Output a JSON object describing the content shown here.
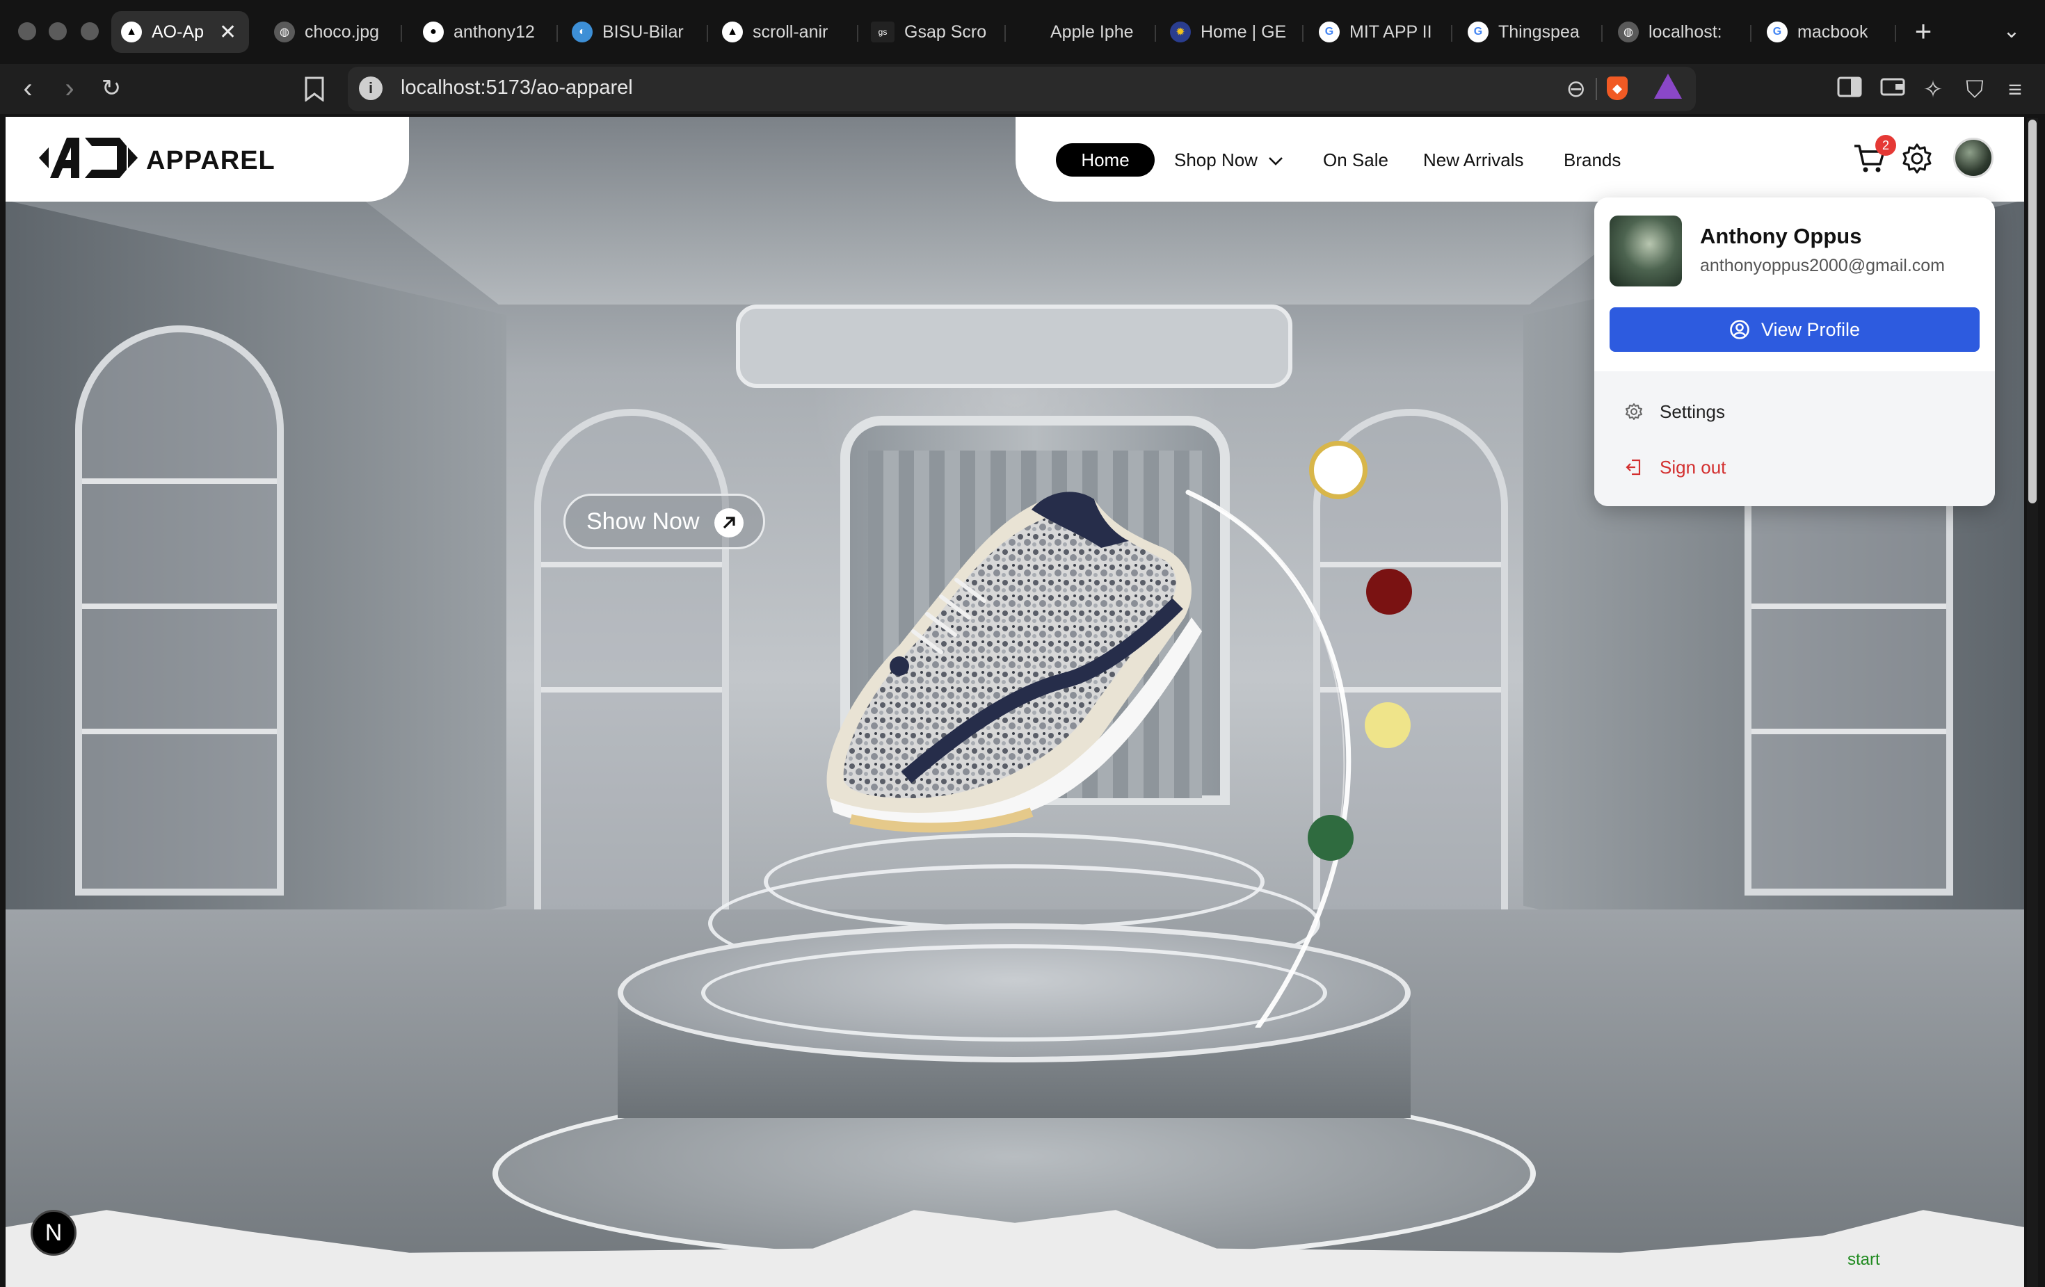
{
  "browser": {
    "tabs": [
      {
        "label": "AO-Ap",
        "active": true
      },
      {
        "label": "choco.jpg"
      },
      {
        "label": "anthony12"
      },
      {
        "label": "BISU-Bilar"
      },
      {
        "label": "scroll-anir"
      },
      {
        "label": "Gsap Scro"
      },
      {
        "label": "Apple Iphe"
      },
      {
        "label": "Home | GE"
      },
      {
        "label": "MIT APP II"
      },
      {
        "label": "Thingspea"
      },
      {
        "label": "localhost:"
      },
      {
        "label": "macbook"
      }
    ],
    "url": "localhost:5173/ao-apparel"
  },
  "header": {
    "brand": "APPAREL",
    "nav": {
      "home": "Home",
      "shop_now": "Shop Now",
      "on_sale": "On Sale",
      "new_arrivals": "New Arrivals",
      "brands": "Brands"
    },
    "cart_count": "2"
  },
  "profile_menu": {
    "name": "Anthony Oppus",
    "email": "anthonyoppus2000@gmail.com",
    "view_profile": "View Profile",
    "settings": "Settings",
    "sign_out": "Sign out"
  },
  "hero": {
    "cta": "Show Now",
    "swatches": [
      "#ffffff",
      "#7a1212",
      "#efe48a",
      "#2f6b3f"
    ]
  },
  "overlay": {
    "badge": "N",
    "start_label": "start"
  },
  "colors": {
    "accent": "#2d5bdf",
    "danger": "#d32f2f",
    "ring": "#d8b64a"
  }
}
